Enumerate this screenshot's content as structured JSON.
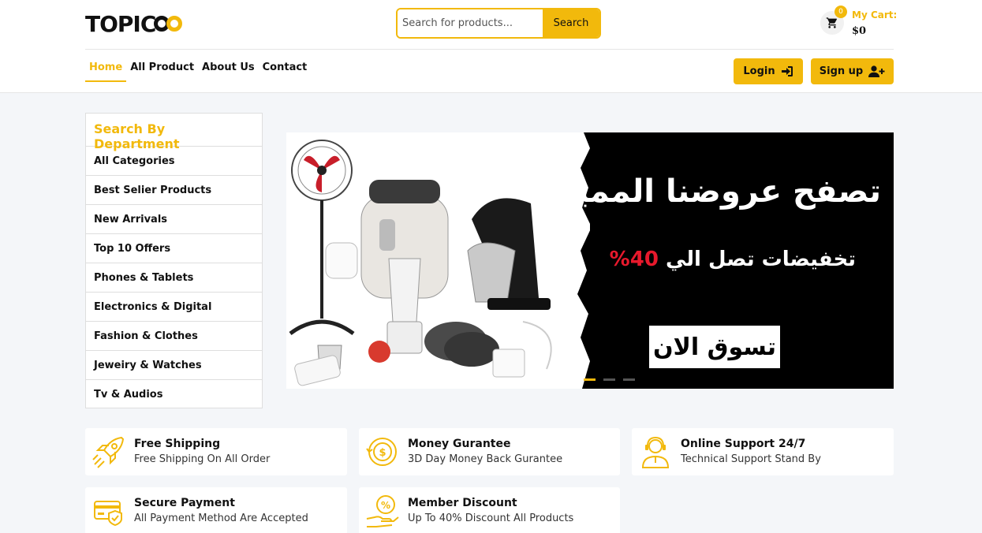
{
  "header": {
    "logo_text": "TOPICO",
    "search": {
      "placeholder": "Search for products...",
      "button_label": "Search"
    },
    "cart": {
      "count": "0",
      "label": "My Cart:",
      "amount": "$0"
    }
  },
  "nav": {
    "items": [
      {
        "label": "Home",
        "active": true
      },
      {
        "label": "All Product",
        "active": false
      },
      {
        "label": "About Us",
        "active": false
      },
      {
        "label": "Contact",
        "active": false
      }
    ],
    "login_label": "Login",
    "signup_label": "Sign up"
  },
  "sidebar": {
    "title": "Search By Department",
    "items": [
      "All Categories",
      "Best Selier Products",
      "New Arrivals",
      "Top 10 Offers",
      "Phones & Tablets",
      "Electronics & Digital",
      "Fashion & Clothes",
      "Jeweiry & Watches",
      "Tv & Audios"
    ]
  },
  "banner": {
    "headline": "تصفح عروضنا المميزة",
    "subline_text": "تخفيضات تصل الي",
    "subline_percent": "40%",
    "cta": "تسوق الان",
    "slides_count": 3,
    "active_slide": 1
  },
  "features": [
    {
      "icon": "rocket-icon",
      "title": "Free Shipping",
      "desc": "Free Shipping On All Order"
    },
    {
      "icon": "money-guarantee-icon",
      "title": "Money Gurantee",
      "desc": "3D Day Money Back Gurantee"
    },
    {
      "icon": "support-agent-icon",
      "title": "Online Support 24/7",
      "desc": "Technical Support Stand By"
    },
    {
      "icon": "credit-card-icon",
      "title": "Secure Payment",
      "desc": "All Payment Method Are Accepted"
    },
    {
      "icon": "discount-hand-icon",
      "title": "Member Discount",
      "desc": "Up To 40% Discount All Products"
    }
  ],
  "colors": {
    "accent": "#f2b90c",
    "background": "#f4f6f9",
    "sale_red": "#e8192c"
  }
}
